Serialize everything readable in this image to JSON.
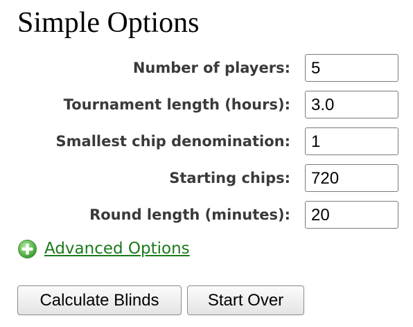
{
  "page": {
    "title": "Simple Options"
  },
  "fields": [
    {
      "label": "Number of players:",
      "value": "5"
    },
    {
      "label": "Tournament length (hours):",
      "value": "3.0"
    },
    {
      "label": "Smallest chip denomination:",
      "value": "1"
    },
    {
      "label": "Starting chips:",
      "value": "720"
    },
    {
      "label": "Round length (minutes):",
      "value": "20"
    }
  ],
  "advanced": {
    "icon": "plus-circle-icon",
    "label": "Advanced Options",
    "color": "#1a7a1a"
  },
  "buttons": {
    "calculate_label": "Calculate Blinds",
    "start_over_label": "Start Over"
  }
}
